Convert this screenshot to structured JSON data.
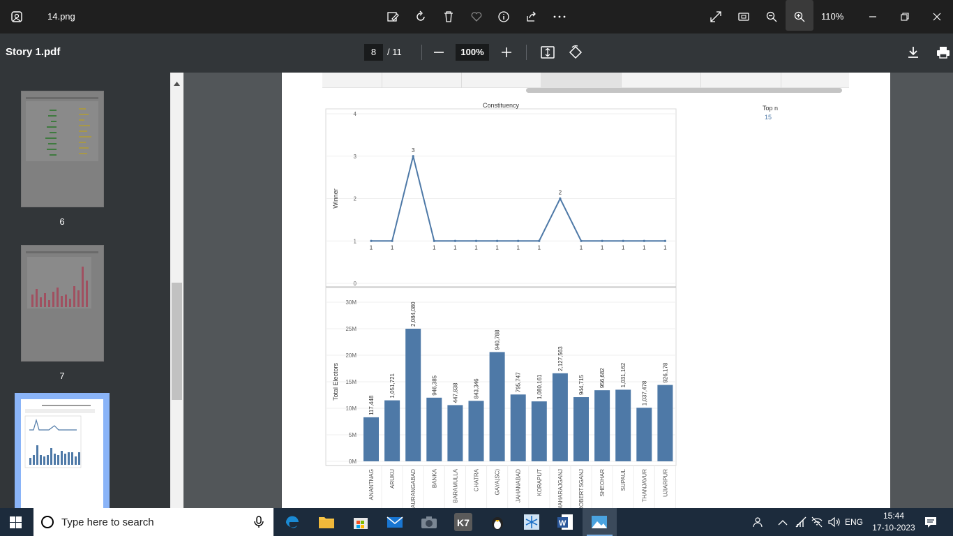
{
  "app": {
    "file_name": "14.png",
    "zoom_label": "110%"
  },
  "pdf": {
    "doc_title": "Story 1.pdf",
    "current_page": "8",
    "total_pages": "/ 11",
    "zoom": "100%"
  },
  "sidebar": {
    "thumbnails": [
      {
        "label": "6"
      },
      {
        "label": "7"
      },
      {
        "label": ""
      }
    ]
  },
  "top_n": {
    "label": "Top n",
    "value": "15"
  },
  "chart_data": [
    {
      "type": "line",
      "title": "Constituency",
      "ylabel": "Winner",
      "ylim": [
        0,
        4
      ],
      "yticks": [
        "0",
        "1",
        "2",
        "3",
        "4"
      ],
      "x": [
        "ANANTNAG",
        "ARUKU",
        "AURANGABAD",
        "BANKA",
        "BARAMULLA",
        "CHATRA",
        "GAYA(SC)",
        "JAHANABAD",
        "KORAPUT",
        "MAHARAJGANJ",
        "ROBERTSGANJ",
        "SHEOHAR",
        "SUPAUL",
        "THANJAVUR",
        "UJIARPUR"
      ],
      "values": [
        1,
        1,
        3,
        1,
        1,
        1,
        1,
        1,
        1,
        2,
        1,
        1,
        1,
        1,
        1
      ],
      "data_labels": [
        "1",
        "1",
        "3",
        "1",
        "1",
        "1",
        "1",
        "1",
        "1",
        "2",
        "1",
        "1",
        "1",
        "1",
        "1"
      ],
      "color": "#4e79a7"
    },
    {
      "type": "bar",
      "ylabel": "Total Electors",
      "ylim": [
        0,
        30000000
      ],
      "yticks": [
        "0M",
        "5M",
        "10M",
        "15M",
        "20M",
        "25M",
        "30M"
      ],
      "categories": [
        "ANANTNAG",
        "ARUKU",
        "AURANGABAD",
        "BANKA",
        "BARAMULLA",
        "CHATRA",
        "GAYA(SC)",
        "JAHANABAD",
        "KORAPUT",
        "MAHARAJGANJ",
        "ROBERTSGANJ",
        "SHEOHAR",
        "SUPAUL",
        "THANJAVUR",
        "UJIARPUR"
      ],
      "values": [
        8300000,
        11500000,
        25000000,
        12000000,
        10600000,
        11400000,
        20600000,
        12600000,
        11300000,
        16600000,
        12100000,
        13400000,
        13500000,
        10100000,
        14400000
      ],
      "data_labels": [
        "117,448",
        "1,051,721",
        "2,084,080",
        "946,385",
        "447,838",
        "843,346",
        "940,788",
        "795,747",
        "1,080,161",
        "2,127,563",
        "944,715",
        "956,682",
        "1,031,162",
        "1,037,478",
        "926,178"
      ],
      "color": "#4e79a7"
    }
  ],
  "taskbar": {
    "search_placeholder": "Type here to search",
    "lang": "ENG",
    "time": "15:44",
    "date": "17-10-2023"
  }
}
